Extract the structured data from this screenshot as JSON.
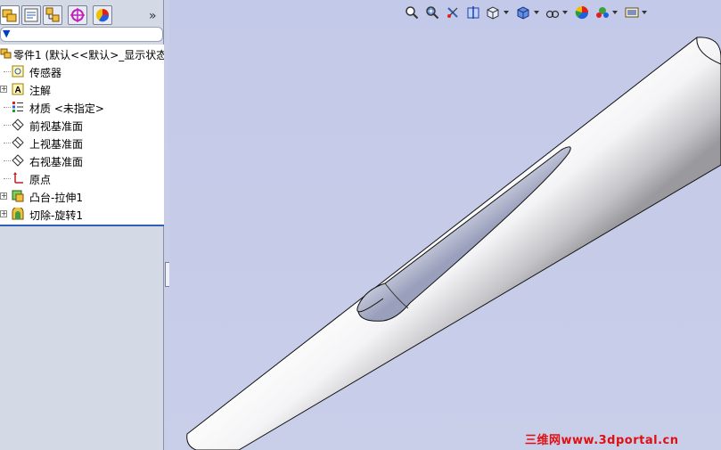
{
  "panel": {
    "overflow": "»",
    "tabs": [
      {
        "name": "feature-manager-tab",
        "icon": "feature-tree-icon",
        "active": true
      },
      {
        "name": "property-manager-tab",
        "icon": "property-icon",
        "active": false
      },
      {
        "name": "configuration-manager-tab",
        "icon": "configuration-icon",
        "active": false
      },
      {
        "name": "dimxpert-tab",
        "icon": "target-icon",
        "active": false
      },
      {
        "name": "display-manager-tab",
        "icon": "appearance-icon",
        "active": false
      }
    ]
  },
  "filter": {
    "icon": "filter-icon"
  },
  "tree": {
    "items": [
      {
        "label": "零件1  (默认<<默认>_显示状态",
        "icon": "part-icon",
        "expandable": false
      },
      {
        "label": "传感器",
        "icon": "sensor-icon",
        "expandable": false
      },
      {
        "label": "注解",
        "icon": "annotation-icon",
        "expandable": true
      },
      {
        "label": "材质 <未指定>",
        "icon": "material-icon",
        "expandable": false
      },
      {
        "label": "前视基准面",
        "icon": "plane-icon",
        "expandable": false
      },
      {
        "label": "上视基准面",
        "icon": "plane-icon",
        "expandable": false
      },
      {
        "label": "右视基准面",
        "icon": "plane-icon",
        "expandable": false
      },
      {
        "label": "原点",
        "icon": "origin-icon",
        "expandable": false
      },
      {
        "label": "凸台-拉伸1",
        "icon": "extrude-icon",
        "expandable": true
      },
      {
        "label": "切除-旋转1",
        "icon": "revolve-cut-icon",
        "expandable": true
      }
    ]
  },
  "toolbar": {
    "icons": [
      "zoom-to-fit-icon",
      "zoom-to-area-icon",
      "previous-view-icon",
      "section-view-icon",
      "view-orientation-icon",
      "display-style-icon",
      "hide-show-items-icon",
      "edit-appearance-icon",
      "apply-scene-icon",
      "view-settings-icon"
    ]
  },
  "watermark": {
    "text": "三维网www.3dportal.cn"
  },
  "colors": {
    "accent": "#3060b0",
    "viewport_bg": "#c8cde8",
    "watermark": "#e01010"
  }
}
